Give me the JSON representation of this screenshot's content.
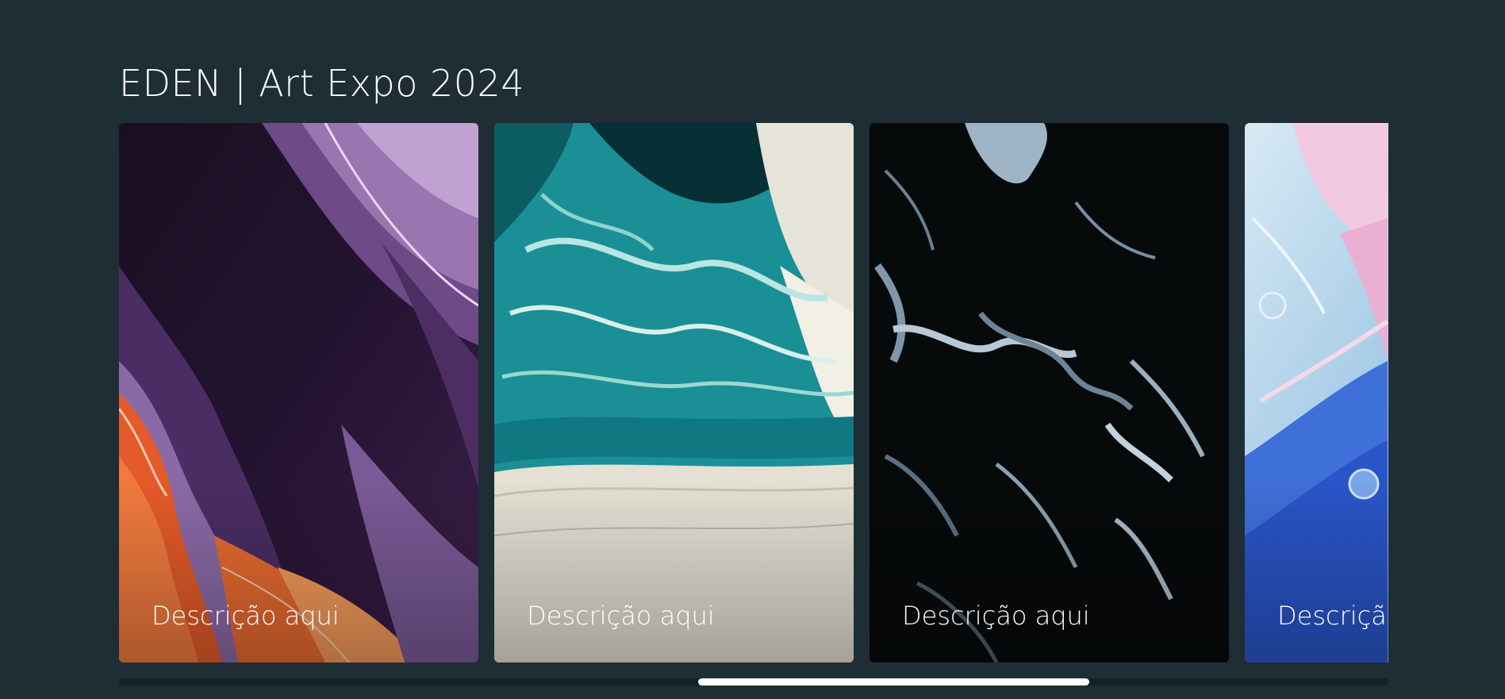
{
  "page": {
    "title": "EDEN | Art Expo 2024"
  },
  "gallery": {
    "cards": [
      {
        "caption": "Descrição aqui",
        "artwork": "purple-orange-fluid-art"
      },
      {
        "caption": "Descrição aqui",
        "artwork": "teal-cream-fluid-art"
      },
      {
        "caption": "Descrição aqui",
        "artwork": "black-silver-fluid-art"
      },
      {
        "caption": "Descrição aqui",
        "artwork": "pastel-blue-pink-fluid-art"
      }
    ]
  },
  "scrollbar": {
    "position": 0.55
  },
  "colors": {
    "background": "#1f2d35",
    "text": "#ffffff",
    "scroll_track": "#142127",
    "scroll_thumb": "#ffffff"
  }
}
